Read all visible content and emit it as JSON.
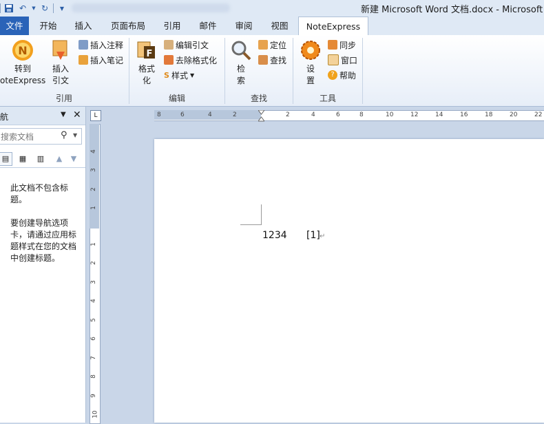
{
  "window": {
    "title": "新建 Microsoft Word 文档.docx - Microsoft W"
  },
  "quick_access": {
    "save_icon": "save-icon",
    "undo_icon": "undo-icon",
    "redo_icon": "redo-icon",
    "customize_icon": "chevron-down-icon"
  },
  "tabs": {
    "file": "文件",
    "home": "开始",
    "insert": "插入",
    "layout": "页面布局",
    "references": "引用",
    "mailings": "邮件",
    "review": "审阅",
    "view": "视图",
    "noteexpress": "NoteExpress"
  },
  "ribbon": {
    "cite_group": {
      "label": "引用",
      "goto_label": "转到\noteExpress",
      "insert_cite_label": "插入\n引文",
      "insert_note": "插入注释",
      "insert_annotation": "插入笔记"
    },
    "edit_group": {
      "label": "编辑",
      "format_label": "格式\n化",
      "edit_cite": "编辑引文",
      "remove_format": "去除格式化",
      "style": "样式"
    },
    "find_group": {
      "label": "查找",
      "search_label": "检\n索",
      "locate": "定位",
      "find": "查找"
    },
    "tools_group": {
      "label": "工具",
      "settings_label": "设\n置",
      "sync": "同步",
      "window": "窗口",
      "help": "帮助"
    }
  },
  "nav_pane": {
    "title": "航",
    "search_placeholder": "搜索文档",
    "msg1": "此文档不包含标题。",
    "msg2": "要创建导航选项卡，请通过应用标题样式在您的文档中创建标题。"
  },
  "ruler": {
    "h_ticks": [
      "8",
      "6",
      "4",
      "2",
      "2",
      "4",
      "6",
      "8",
      "10",
      "12",
      "14",
      "16",
      "18",
      "20",
      "22"
    ],
    "v_ticks": [
      "4",
      "3",
      "2",
      "1",
      "1",
      "2",
      "3",
      "4",
      "5",
      "6",
      "7",
      "8",
      "9",
      "10"
    ]
  },
  "document": {
    "text": "1234",
    "citation": "[1]",
    "para_mark": "↵"
  },
  "colors": {
    "file_tab": "#2a63b8",
    "ribbon_bg": "#ffffff",
    "frame": "#c9d6e8"
  }
}
